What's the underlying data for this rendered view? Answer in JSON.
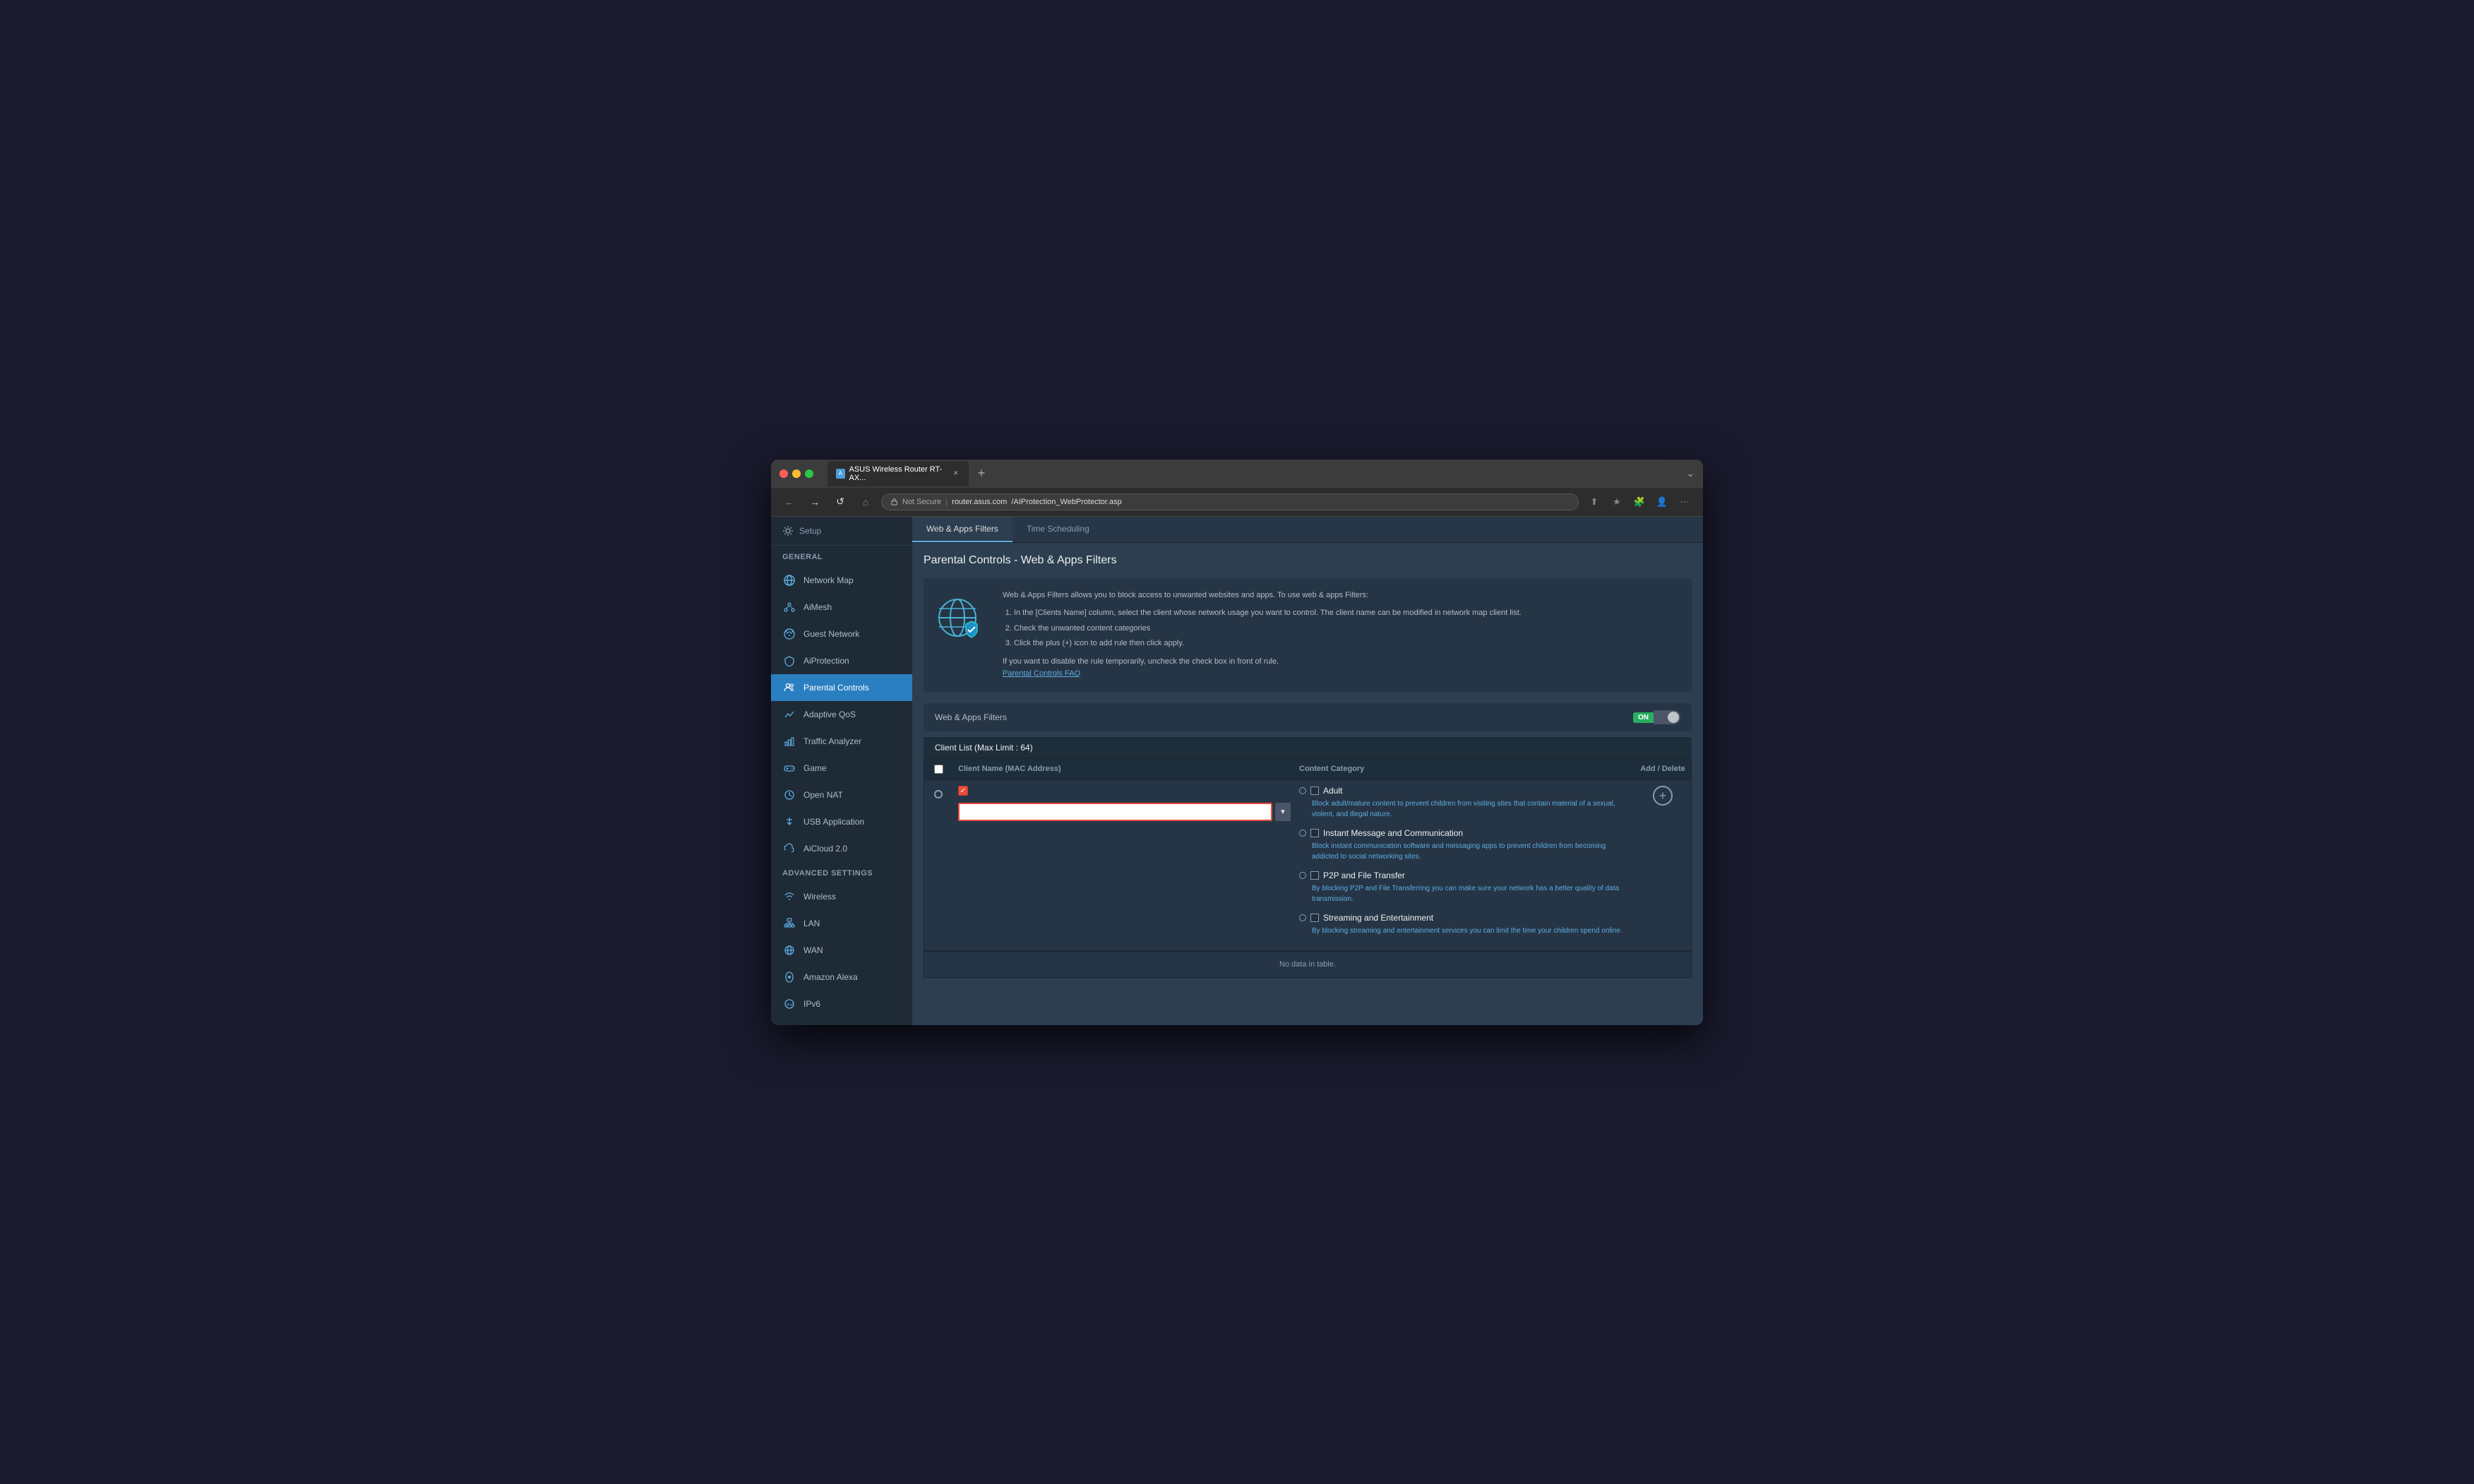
{
  "browser": {
    "tab_title": "ASUS Wireless Router RT-AX...",
    "tab_favicon": "A",
    "url_not_secure": "Not Secure",
    "url_domain": "router.asus.com",
    "url_path": "/AIProtection_WebProtector.asp"
  },
  "sidebar": {
    "setup_label": "Setup",
    "general_label": "General",
    "items": [
      {
        "id": "network-map",
        "label": "Network Map",
        "icon": "globe"
      },
      {
        "id": "aimesh",
        "label": "AiMesh",
        "icon": "mesh"
      },
      {
        "id": "guest-network",
        "label": "Guest Network",
        "icon": "wifi"
      },
      {
        "id": "aiprotection",
        "label": "AiProtection",
        "icon": "shield"
      },
      {
        "id": "parental-controls",
        "label": "Parental Controls",
        "icon": "people",
        "active": true
      },
      {
        "id": "adaptive-qos",
        "label": "Adaptive QoS",
        "icon": "chart"
      },
      {
        "id": "traffic-analyzer",
        "label": "Traffic Analyzer",
        "icon": "bar"
      },
      {
        "id": "game",
        "label": "Game",
        "icon": "gamepad"
      },
      {
        "id": "open-nat",
        "label": "Open NAT",
        "icon": "nat"
      },
      {
        "id": "usb-application",
        "label": "USB Application",
        "icon": "usb"
      },
      {
        "id": "aicloud",
        "label": "AiCloud 2.0",
        "icon": "cloud"
      }
    ],
    "advanced_label": "Advanced Settings",
    "advanced_items": [
      {
        "id": "wireless",
        "label": "Wireless",
        "icon": "wifi2"
      },
      {
        "id": "lan",
        "label": "LAN",
        "icon": "lan"
      },
      {
        "id": "wan",
        "label": "WAN",
        "icon": "wan"
      },
      {
        "id": "amazon-alexa",
        "label": "Amazon Alexa",
        "icon": "alexa"
      },
      {
        "id": "ipv6",
        "label": "IPv6",
        "icon": "ipv6"
      }
    ]
  },
  "tabs": [
    {
      "id": "web-apps-filters",
      "label": "Web & Apps Filters",
      "active": true
    },
    {
      "id": "time-scheduling",
      "label": "Time Scheduling",
      "active": false
    }
  ],
  "page": {
    "title": "Parental Controls - Web & Apps Filters",
    "info_text": "Web & Apps Filters allows you to block access to unwanted websites and apps. To use web & apps Filters:",
    "steps": [
      "In the [Clients Name] column, select the client whose network usage you want to control. The client name can be modified in network map client list.",
      "Check the unwanted content categories",
      "Click the plus (+) icon to add rule then click apply."
    ],
    "disable_text": "If you want to disable the rule temporarily, uncheck the check box in front of rule.",
    "faq_link": "Parental Controls FAQ",
    "toggle_label": "Web & Apps Filters",
    "toggle_state": "ON",
    "client_list_header": "Client List (Max Limit : 64)",
    "table_headers": {
      "checkbox": "",
      "client_name": "Client Name (MAC Address)",
      "content_category": "Content Category",
      "add_delete": "Add / Delete"
    },
    "categories": [
      {
        "id": "adult",
        "name": "Adult",
        "checked": false,
        "desc": "Block adult/mature content to prevent children from visiting sites that contain material of a sexual, violent, and illegal nature."
      },
      {
        "id": "instant-message",
        "name": "Instant Message and Communication",
        "checked": false,
        "desc": "Block instant communication software and messaging apps to prevent children from becoming addicted to social networking sites."
      },
      {
        "id": "p2p",
        "name": "P2P and File Transfer",
        "checked": false,
        "desc": "By blocking P2P and File Transferring you can make sure your network has a better quality of data transmission."
      },
      {
        "id": "streaming",
        "name": "Streaming and Entertainment",
        "checked": false,
        "desc": "By blocking streaming and entertainment services you can limit the time your children spend online."
      }
    ],
    "no_data": "No data in table.",
    "client_input_placeholder": ""
  }
}
